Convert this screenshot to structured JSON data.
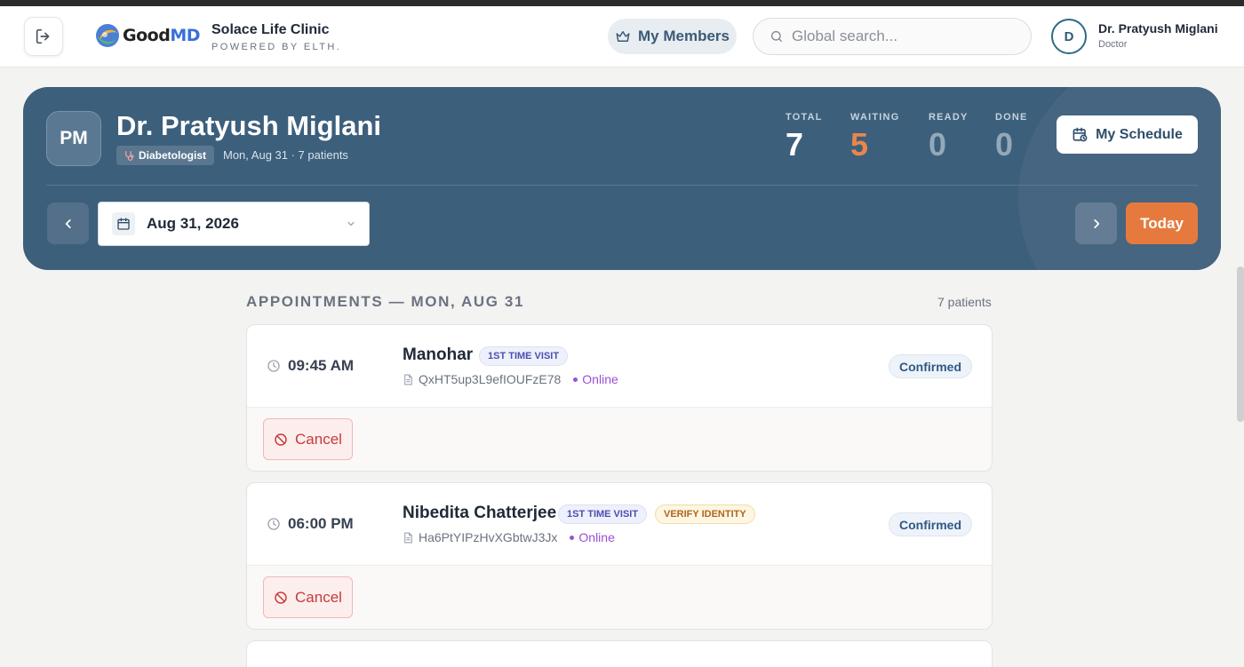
{
  "header": {
    "logo_good": "Good",
    "logo_md": "MD",
    "clinic_name": "Solace Life Clinic",
    "clinic_sub": "POWERED BY ELTH.",
    "members_label": "My Members",
    "search_placeholder": "Global search...",
    "user_initial": "D",
    "user_name": "Dr. Pratyush Miglani",
    "user_role": "Doctor"
  },
  "hero": {
    "initials": "PM",
    "doctor_name": "Dr. Pratyush Miglani",
    "specialty": "Diabetologist",
    "meta": "Mon, Aug 31 · 7 patients",
    "stats": {
      "total_label": "TOTAL",
      "total_value": "7",
      "waiting_label": "WAITING",
      "waiting_value": "5",
      "ready_label": "READY",
      "ready_value": "0",
      "done_label": "DONE",
      "done_value": "0"
    },
    "schedule_label": "My Schedule",
    "date_value": "Aug 31, 2026",
    "today_label": "Today"
  },
  "appointments": {
    "title": "APPOINTMENTS — MON, AUG 31",
    "count": "7 patients",
    "items": [
      {
        "time": "09:45 AM",
        "name": "Manohar",
        "badge_visit": "1ST TIME VISIT",
        "id": "QxHT5up3L9efIOUFzE78",
        "mode": "Online",
        "status": "Confirmed",
        "cancel_label": "Cancel"
      },
      {
        "time": "06:00 PM",
        "name": "Nibedita Chatterjee",
        "badge_visit": "1ST TIME VISIT",
        "badge_verify": "VERIFY IDENTITY",
        "id": "Ha6PtYIPzHvXGbtwJ3Jx",
        "mode": "Online",
        "status": "Confirmed",
        "cancel_label": "Cancel"
      }
    ]
  },
  "colors": {
    "hero_bg": "#3c5f7c",
    "accent_orange": "#e67a3e",
    "online_purple": "#9b4fd6",
    "cancel_red": "#c73a3a"
  }
}
